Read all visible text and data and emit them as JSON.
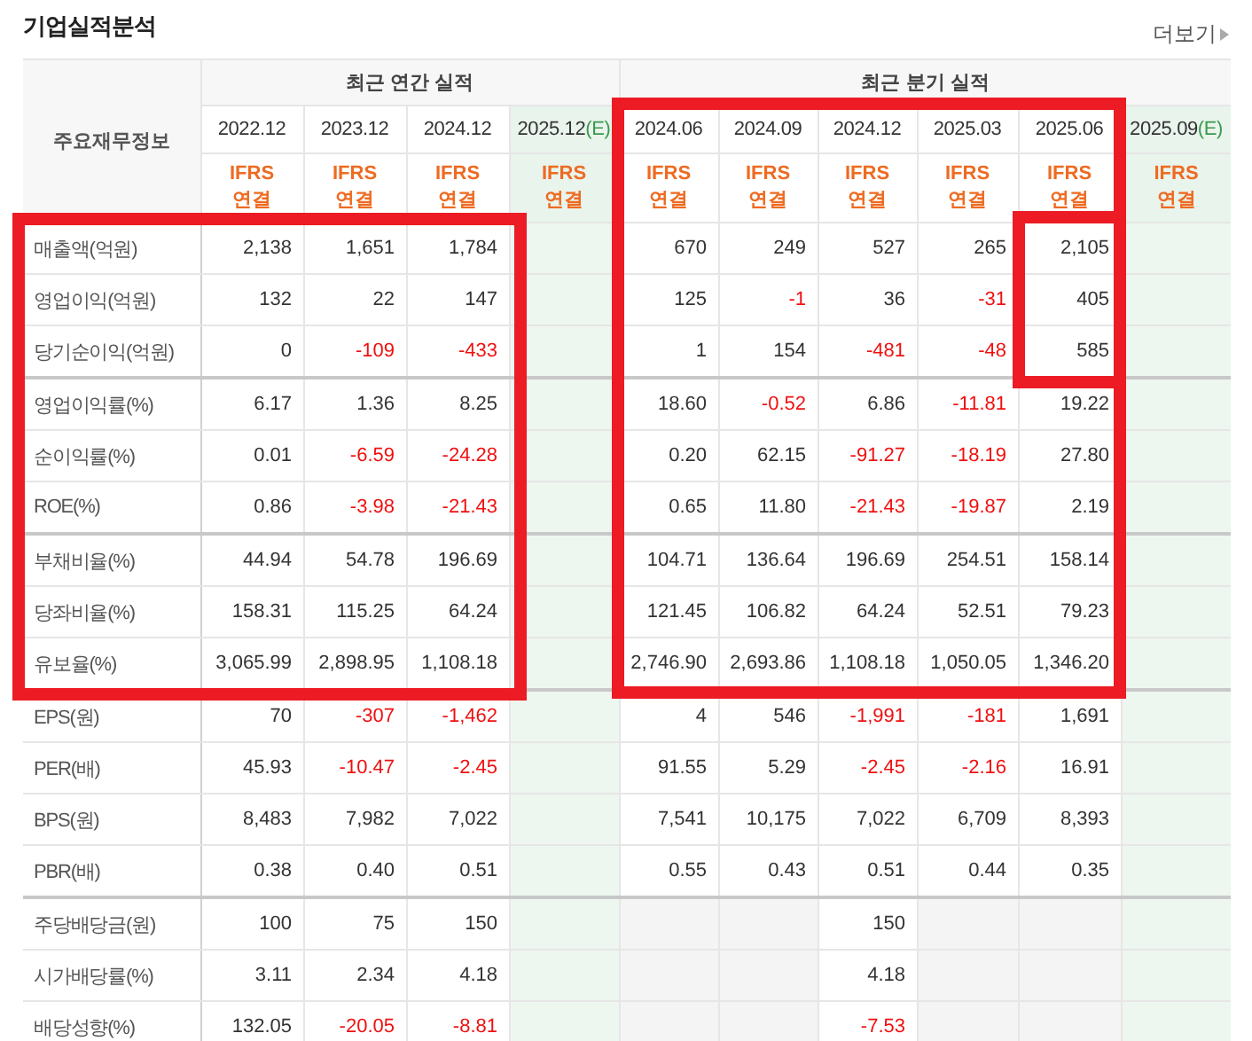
{
  "title": "기업실적분석",
  "more": {
    "label": "더보기"
  },
  "table": {
    "corner": "주요재무정보",
    "groups": [
      {
        "label": "최근 연간 실적",
        "columns": [
          {
            "date": "2022.12",
            "estimate": false,
            "basis": "IFRS 연결"
          },
          {
            "date": "2023.12",
            "estimate": false,
            "basis": "IFRS 연결"
          },
          {
            "date": "2024.12",
            "estimate": false,
            "basis": "IFRS 연결"
          },
          {
            "date": "2025.12",
            "mark": "(E)",
            "estimate": true,
            "basis": "IFRS 연결"
          }
        ]
      },
      {
        "label": "최근 분기 실적",
        "columns": [
          {
            "date": "2024.06",
            "estimate": false,
            "basis": "IFRS 연결"
          },
          {
            "date": "2024.09",
            "estimate": false,
            "basis": "IFRS 연결"
          },
          {
            "date": "2024.12",
            "estimate": false,
            "basis": "IFRS 연결"
          },
          {
            "date": "2025.03",
            "estimate": false,
            "basis": "IFRS 연결"
          },
          {
            "date": "2025.06",
            "estimate": false,
            "basis": "IFRS 연결"
          },
          {
            "date": "2025.09",
            "mark": "(E)",
            "estimate": true,
            "basis": "IFRS 연결"
          }
        ]
      }
    ],
    "rows": [
      {
        "label": "매출액(억원)",
        "group_end": false,
        "cells": [
          {
            "value": "2,138"
          },
          {
            "value": "1,651"
          },
          {
            "value": "1,784"
          },
          {
            "empty": true
          },
          {
            "value": "670"
          },
          {
            "value": "249"
          },
          {
            "value": "527"
          },
          {
            "value": "265"
          },
          {
            "value": "2,105"
          },
          {
            "empty": true
          }
        ]
      },
      {
        "label": "영업이익(억원)",
        "group_end": false,
        "cells": [
          {
            "value": "132"
          },
          {
            "value": "22"
          },
          {
            "value": "147"
          },
          {
            "empty": true
          },
          {
            "value": "125"
          },
          {
            "value": "-1"
          },
          {
            "value": "36"
          },
          {
            "value": "-31"
          },
          {
            "value": "405"
          },
          {
            "empty": true
          }
        ]
      },
      {
        "label": "당기순이익(억원)",
        "group_end": true,
        "cells": [
          {
            "value": "0"
          },
          {
            "value": "-109"
          },
          {
            "value": "-433"
          },
          {
            "empty": true
          },
          {
            "value": "1"
          },
          {
            "value": "154"
          },
          {
            "value": "-481"
          },
          {
            "value": "-48"
          },
          {
            "value": "585"
          },
          {
            "empty": true
          }
        ]
      },
      {
        "label": "영업이익률(%)",
        "group_end": false,
        "cells": [
          {
            "value": "6.17"
          },
          {
            "value": "1.36"
          },
          {
            "value": "8.25"
          },
          {
            "empty": true
          },
          {
            "value": "18.60"
          },
          {
            "value": "-0.52"
          },
          {
            "value": "6.86"
          },
          {
            "value": "-11.81"
          },
          {
            "value": "19.22"
          },
          {
            "empty": true
          }
        ]
      },
      {
        "label": "순이익률(%)",
        "group_end": false,
        "cells": [
          {
            "value": "0.01"
          },
          {
            "value": "-6.59"
          },
          {
            "value": "-24.28"
          },
          {
            "empty": true
          },
          {
            "value": "0.20"
          },
          {
            "value": "62.15"
          },
          {
            "value": "-91.27"
          },
          {
            "value": "-18.19"
          },
          {
            "value": "27.80"
          },
          {
            "empty": true
          }
        ]
      },
      {
        "label": "ROE(%)",
        "group_end": true,
        "cells": [
          {
            "value": "0.86"
          },
          {
            "value": "-3.98"
          },
          {
            "value": "-21.43"
          },
          {
            "empty": true
          },
          {
            "value": "0.65"
          },
          {
            "value": "11.80"
          },
          {
            "value": "-21.43"
          },
          {
            "value": "-19.87"
          },
          {
            "value": "2.19"
          },
          {
            "empty": true
          }
        ]
      },
      {
        "label": "부채비율(%)",
        "group_end": false,
        "cells": [
          {
            "value": "44.94"
          },
          {
            "value": "54.78"
          },
          {
            "value": "196.69"
          },
          {
            "empty": true
          },
          {
            "value": "104.71"
          },
          {
            "value": "136.64"
          },
          {
            "value": "196.69"
          },
          {
            "value": "254.51"
          },
          {
            "value": "158.14"
          },
          {
            "empty": true
          }
        ]
      },
      {
        "label": "당좌비율(%)",
        "group_end": false,
        "cells": [
          {
            "value": "158.31"
          },
          {
            "value": "115.25"
          },
          {
            "value": "64.24"
          },
          {
            "empty": true
          },
          {
            "value": "121.45"
          },
          {
            "value": "106.82"
          },
          {
            "value": "64.24"
          },
          {
            "value": "52.51"
          },
          {
            "value": "79.23"
          },
          {
            "empty": true
          }
        ]
      },
      {
        "label": "유보율(%)",
        "group_end": true,
        "cells": [
          {
            "value": "3,065.99"
          },
          {
            "value": "2,898.95"
          },
          {
            "value": "1,108.18"
          },
          {
            "empty": true
          },
          {
            "value": "2,746.90"
          },
          {
            "value": "2,693.86"
          },
          {
            "value": "1,108.18"
          },
          {
            "value": "1,050.05"
          },
          {
            "value": "1,346.20"
          },
          {
            "empty": true
          }
        ]
      },
      {
        "label": "EPS(원)",
        "group_end": false,
        "cells": [
          {
            "value": "70"
          },
          {
            "value": "-307"
          },
          {
            "value": "-1,462"
          },
          {
            "empty": true
          },
          {
            "value": "4"
          },
          {
            "value": "546"
          },
          {
            "value": "-1,991"
          },
          {
            "value": "-181"
          },
          {
            "value": "1,691"
          },
          {
            "empty": true
          }
        ]
      },
      {
        "label": "PER(배)",
        "group_end": false,
        "cells": [
          {
            "value": "45.93"
          },
          {
            "value": "-10.47"
          },
          {
            "value": "-2.45"
          },
          {
            "empty": true
          },
          {
            "value": "91.55"
          },
          {
            "value": "5.29"
          },
          {
            "value": "-2.45"
          },
          {
            "value": "-2.16"
          },
          {
            "value": "16.91"
          },
          {
            "empty": true
          }
        ]
      },
      {
        "label": "BPS(원)",
        "group_end": false,
        "cells": [
          {
            "value": "8,483"
          },
          {
            "value": "7,982"
          },
          {
            "value": "7,022"
          },
          {
            "empty": true
          },
          {
            "value": "7,541"
          },
          {
            "value": "10,175"
          },
          {
            "value": "7,022"
          },
          {
            "value": "6,709"
          },
          {
            "value": "8,393"
          },
          {
            "empty": true
          }
        ]
      },
      {
        "label": "PBR(배)",
        "group_end": true,
        "cells": [
          {
            "value": "0.38"
          },
          {
            "value": "0.40"
          },
          {
            "value": "0.51"
          },
          {
            "empty": true
          },
          {
            "value": "0.55"
          },
          {
            "value": "0.43"
          },
          {
            "value": "0.51"
          },
          {
            "value": "0.44"
          },
          {
            "value": "0.35"
          },
          {
            "empty": true
          }
        ]
      },
      {
        "label": "주당배당금(원)",
        "group_end": false,
        "cells": [
          {
            "value": "100"
          },
          {
            "value": "75"
          },
          {
            "value": "150"
          },
          {
            "empty": true
          },
          {
            "empty": true
          },
          {
            "empty": true
          },
          {
            "value": "150"
          },
          {
            "empty": true
          },
          {
            "empty": true
          },
          {
            "empty": true
          }
        ]
      },
      {
        "label": "시가배당률(%)",
        "group_end": false,
        "cells": [
          {
            "value": "3.11"
          },
          {
            "value": "2.34"
          },
          {
            "value": "4.18"
          },
          {
            "empty": true
          },
          {
            "empty": true
          },
          {
            "empty": true
          },
          {
            "value": "4.18"
          },
          {
            "empty": true
          },
          {
            "empty": true
          },
          {
            "empty": true
          }
        ]
      },
      {
        "label": "배당성향(%)",
        "group_end": false,
        "cells": [
          {
            "value": "132.05"
          },
          {
            "value": "-20.05"
          },
          {
            "value": "-8.81"
          },
          {
            "empty": true
          },
          {
            "empty": true
          },
          {
            "empty": true
          },
          {
            "value": "-7.53"
          },
          {
            "empty": true
          },
          {
            "empty": true
          },
          {
            "empty": true
          }
        ]
      }
    ]
  },
  "highlights": [
    {
      "kind": "annual"
    },
    {
      "kind": "quarterly"
    },
    {
      "kind": "latest"
    }
  ]
}
